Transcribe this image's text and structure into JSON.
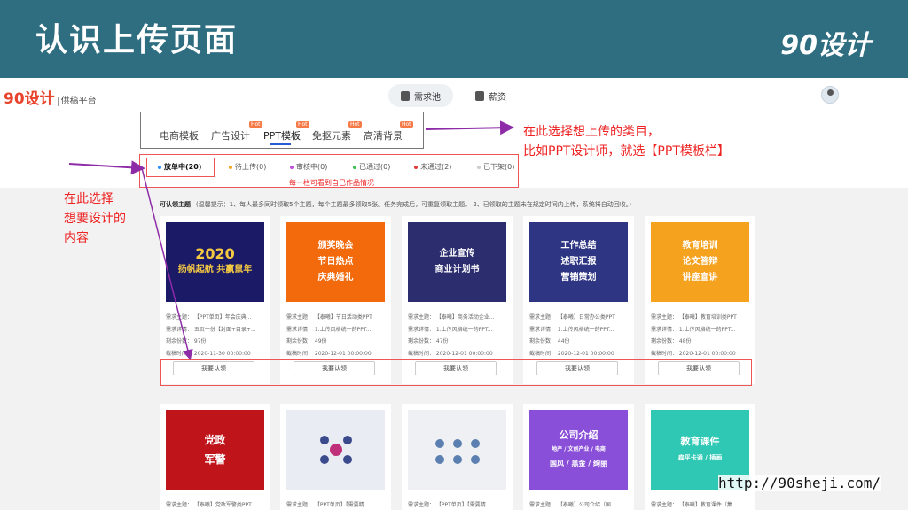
{
  "slide": {
    "title": "认识上传页面",
    "brand": "90设计"
  },
  "header": {
    "logo": "90设计",
    "logo_sub": "供稿平台",
    "nav": [
      {
        "label": "需求池",
        "icon": "list-icon",
        "active": true
      },
      {
        "label": "薪资",
        "icon": "wallet-icon",
        "active": false
      }
    ]
  },
  "categories": [
    {
      "label": "电商模板",
      "badge": ""
    },
    {
      "label": "广告设计",
      "badge": "Hot"
    },
    {
      "label": "PPT模板",
      "badge": "Hot",
      "active": true
    },
    {
      "label": "免抠元素",
      "badge": "Hot"
    },
    {
      "label": "高清背景",
      "badge": "Hot"
    }
  ],
  "status_tabs": [
    {
      "label": "放单中(20)",
      "dot_color": "#2a8cff",
      "active": true
    },
    {
      "label": "待上传(0)",
      "dot_color": "#f5a623"
    },
    {
      "label": "审核中(0)",
      "dot_color": "#c04fd8"
    },
    {
      "label": "已通过(0)",
      "dot_color": "#3cc14f"
    },
    {
      "label": "未通过(2)",
      "dot_color": "#e23b3b"
    },
    {
      "label": "已下架(0)",
      "dot_color": "#cccccc"
    }
  ],
  "status_note": "每一栏可看到自己作品情况",
  "notice": {
    "label": "可认领主题",
    "text": "(温馨提示：1、每人最多同时领取5个主题，每个主题最多领取5张。任务完成后，可重复领取主题。 2、已领取的主题未在规定时间内上传，系统将自动回收。)"
  },
  "cards_row1": [
    {
      "thumb_lines": [
        "2020",
        "扬帆起航 共赢鼠年"
      ],
      "theme": "需求主题：  【PPT单页】年会庆典...",
      "detail": "需求详情：  五页一份【封面+目录+...",
      "remaining": "剩余份数：  97份",
      "deadline": "截稿时间：  2020-11-30 00:00:00",
      "button": "我要认领",
      "color": "#1a1a66"
    },
    {
      "thumb_lines": [
        "颁奖晚会",
        "节日热点",
        "庆典婚礼"
      ],
      "theme": "需求主题：  【泰曦】节日活动类PPT",
      "detail": "需求详情：  1.上传风格统一的PPT...",
      "remaining": "剩余份数：  49份",
      "deadline": "截稿时间：  2020-12-01 00:00:00",
      "button": "我要认领",
      "color": "#f26a0c"
    },
    {
      "thumb_lines": [
        "企业宣传",
        "商业计划书"
      ],
      "theme": "需求主题：  【泰曦】商务活动企业...",
      "detail": "需求详情：  1.上传风格统一的PPT...",
      "remaining": "剩余份数：  47份",
      "deadline": "截稿时间：  2020-12-01 00:00:00",
      "button": "我要认领",
      "color": "#2b2d6e"
    },
    {
      "thumb_lines": [
        "工作总结",
        "述职汇报",
        "营销策划"
      ],
      "theme": "需求主题：  【泰曦】日常办公类PPT",
      "detail": "需求详情：  1.上传风格统一的PPT...",
      "remaining": "剩余份数：  44份",
      "deadline": "截稿时间：  2020-12-01 00:00:00",
      "button": "我要认领",
      "color": "#2e3582"
    },
    {
      "thumb_lines": [
        "教育培训",
        "论文答辩",
        "讲座宣讲"
      ],
      "theme": "需求主题：  【泰曦】教育培训类PPT",
      "detail": "需求详情：  1.上传风格统一的PPT...",
      "remaining": "剩余份数：  48份",
      "deadline": "截稿时间：  2020-12-01 00:00:00",
      "button": "我要认领",
      "color": "#f5a21e"
    }
  ],
  "cards_row2": [
    {
      "thumb_lines": [
        "党政",
        "军警"
      ],
      "theme": "需求主题：  【泰曦】党政军警类PPT",
      "color": "#c0141b"
    },
    {
      "thumb_lines": [],
      "theme": "需求主题：  【PPT单页】【需要精...",
      "color": "#e9ecf3"
    },
    {
      "thumb_lines": [],
      "theme": "需求主题：  【PPT单页】【需要精...",
      "color": "#eef0f4"
    },
    {
      "thumb_lines": [
        "公司介绍",
        "地产 / 文创产业 / 电商",
        "国风 / 黑金 / 绚丽"
      ],
      "theme": "需求主题：  【泰曦】公司介绍（国...",
      "color": "#8a4fd8"
    },
    {
      "thumb_lines": [
        "教育课件",
        "扁平卡通 / 插画"
      ],
      "theme": "需求主题：  【泰曦】教育课件（集...",
      "color": "#2ec8b4"
    }
  ],
  "annotations": {
    "right_line1": "在此选择想上传的类目，",
    "right_line2": "比如PPT设计师，就选【PPT模板栏】",
    "left_line1": "在此选择",
    "left_line2": "想要设计的",
    "left_line3": "内容"
  },
  "url": "http://90sheji.com/"
}
